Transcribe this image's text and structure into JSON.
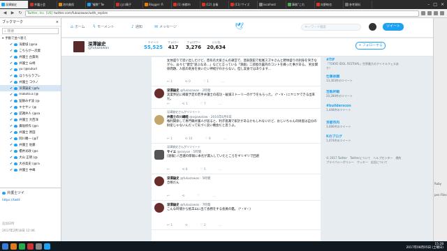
{
  "browser": {
    "tabs": [
      {
        "label": "深澤諭史",
        "color": "#1da1f2",
        "active": true
      },
      {
        "label": "弁護士会",
        "color": "#c33"
      },
      {
        "label": "池内美保",
        "color": "#e08a1a"
      },
      {
        "label": "\"複数\" Tw",
        "color": "#1da1f2"
      },
      {
        "label": "山口晴子",
        "color": "#c33"
      },
      {
        "label": "Blogger: R",
        "color": "#f57c00"
      },
      {
        "label": "(1) 新都市",
        "color": "#d32"
      },
      {
        "label": "(12) 自衛",
        "color": "#d32"
      },
      {
        "label": "(11) サイズ",
        "color": "#d32"
      },
      {
        "label": "localhost",
        "color": "#888"
      },
      {
        "label": "事務“これ",
        "color": "#5a5"
      },
      {
        "label": "向野純也",
        "color": "#d32"
      },
      {
        "label": "参考資料",
        "color": "#777"
      }
    ],
    "url_badge": "Twitter, Inc. [US]",
    "url": "twitter.com/fukazawas/with_replies"
  },
  "sidebar": {
    "title": "ブックマーク",
    "search_placeholder": "検索",
    "folder_label": "手動で並べ替え",
    "items": [
      {
        "label": "海菱城 (@na"
      },
      {
        "label": "こちらが一次資"
      },
      {
        "label": "弁護士 古賀尚"
      },
      {
        "label": "弁護士 山崎"
      },
      {
        "label": "yu (@sukuri"
      },
      {
        "label": "ほうちらラブレ"
      },
      {
        "label": "弁護士 コウノ"
      },
      {
        "label": "深澤諭史 (@fu",
        "selected": true
      },
      {
        "label": "makoto.a (@"
      },
      {
        "label": "猛静みず波 (@"
      },
      {
        "label": "キセサン (@"
      },
      {
        "label": "認識弁人 (@sa"
      },
      {
        "label": "弁護士 大西洋"
      },
      {
        "label": "廣坂修作 (@n"
      },
      {
        "label": "弁護士 原田"
      },
      {
        "label": "岡川羅一 (@T"
      },
      {
        "label": "弁護士 佐藤"
      },
      {
        "label": "櫻井光政 (@s"
      },
      {
        "label": "大山 正明 (@"
      },
      {
        "label": "大谷高史 (@ra"
      },
      {
        "label": "弁護士 中峰"
      }
    ],
    "preview_title": "弁護士ツイ",
    "preview_url": "https://twitt",
    "added_label": "追加日時",
    "added_date": "2017年2月18日 12:46"
  },
  "twitter": {
    "nav": {
      "home": "ホーム",
      "moments": "モーメント",
      "notifications": "通知",
      "messages": "メッセージ"
    },
    "search_placeholder": "キーワード検索",
    "tweet_button": "ツイート",
    "profile": {
      "name": "深澤諭史",
      "handle": "@fukazawas",
      "stats": [
        {
          "label": "ツイート",
          "value": "55,525",
          "active": true
        },
        {
          "label": "フォロー",
          "value": "417"
        },
        {
          "label": "フォロワー",
          "value": "3,276"
        },
        {
          "label": "いいね",
          "value": "20,634"
        }
      ],
      "follow_label": "フォローする"
    },
    "tweets": [
      {
        "retweet_note": "",
        "name": "",
        "handle": "",
        "time": "",
        "body": "女体盛りで思い出したけど、昔有名大家さんの運営で、温泉旅館で松尾スズキさんと野体盛りの刺身を突きながら、淡々と\"健全\"遊ぶなあ…」などと言っている「演劇」二部屋の露内のコントを繰った事がある。 男女関係問題、人肌の刺身を食いたい神経がわからない。但し実食ではあります…",
        "actions": [
          "1",
          "0",
          "1"
        ]
      },
      {
        "retweet_note": "",
        "name": "深澤諭史",
        "handle": "@fukazawas",
        "time": "· 2時間",
        "body": "実業界記に掲載予定の若手弁護士の成功・破滅ストーリーのゲラをもらった。 (*・∀・)ニヤニヤできる出来だ。",
        "actions": [
          "",
          "1",
          "7"
        ]
      },
      {
        "retweet_note": "深澤諭史さんがリツイート",
        "name": "弁護士の川嶋睦",
        "handle": "@ogawalaw",
        "time": "· 2016年6月6日",
        "body": "権利関係して専門職弁護人が居ると、利子意識で家計があるかもしれないけど、おじいちゃんの財産は自分の財産じゃないんだって気づく良い機会だと思うよ。",
        "actions": [
          "1",
          "10",
          "9"
        ]
      },
      {
        "retweet_note": "深澤諭史さんがリツイート",
        "name": "サイエ",
        "handle": "@saiyue",
        "time": "· 5時間",
        "body": "[速報] 八百選の厚報に本名が漏入していたところをギリギリで回避",
        "actions": [
          "",
          "8",
          "5"
        ]
      },
      {
        "retweet_note": "",
        "name": "深澤諭史",
        "handle": "@fukazawas",
        "time": "· 5時間",
        "body": "合格だん",
        "actions": [
          "",
          "",
          ""
        ]
      },
      {
        "retweet_note": "",
        "name": "深澤諭史",
        "handle": "@fukazawas",
        "time": "· 7時間",
        "body": "こんな時間から抵羊山に出て会務をする会員の鑑。 (*・∀・)",
        "actions": [
          "1",
          "",
          "2"
        ]
      }
    ],
    "trends": [
      {
        "title": "#TIF",
        "desc": "「TOKYO IDOL FESTIVAL」世界最大のアイドルフェスあり！"
      },
      {
        "title": "仕事依頼",
        "desc": "13,303件のツイート"
      },
      {
        "title": "百敗杯戦",
        "desc": "20,280件のツイート"
      },
      {
        "title": "#builderscon",
        "desc": "1,448件のツイート"
      },
      {
        "title": "京都市内",
        "desc": "3,086件のツイート"
      },
      {
        "title": "Kのブログ",
        "desc": "1,074件のツイート"
      }
    ],
    "footer": "© 2017 Twitter　Twitterについて　ヘルプセンター　規約　プライバシーポリシー　クッキー　広告について"
  },
  "right_strip": {
    "words": [
      "Ruby",
      "pen Files"
    ]
  },
  "taskbar": {
    "time": "15:28",
    "date": "2017年08月05日 (土曜日)"
  }
}
